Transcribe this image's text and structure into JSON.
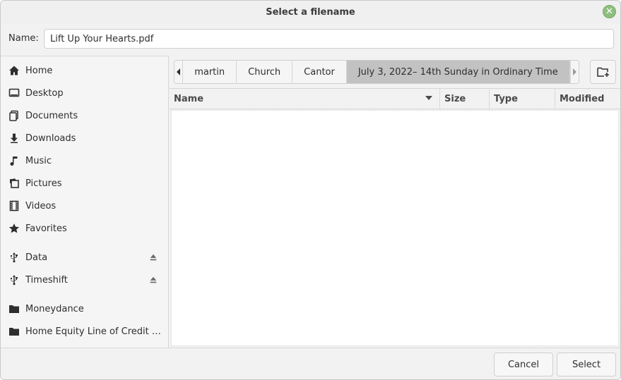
{
  "window": {
    "title": "Select a filename",
    "close_glyph": "✕"
  },
  "name_field": {
    "label": "Name:",
    "value": "Lift Up Your Hearts.pdf"
  },
  "sidebar": {
    "items": [
      {
        "label": "Home",
        "icon": "home-icon"
      },
      {
        "label": "Desktop",
        "icon": "desktop-icon"
      },
      {
        "label": "Documents",
        "icon": "documents-icon"
      },
      {
        "label": "Downloads",
        "icon": "downloads-icon"
      },
      {
        "label": "Music",
        "icon": "music-icon"
      },
      {
        "label": "Pictures",
        "icon": "pictures-icon"
      },
      {
        "label": "Videos",
        "icon": "videos-icon"
      },
      {
        "label": "Favorites",
        "icon": "star-icon"
      },
      {
        "label": "Data",
        "icon": "usb-icon",
        "eject": true
      },
      {
        "label": "Timeshift",
        "icon": "usb-icon",
        "eject": true
      },
      {
        "label": "Moneydance",
        "icon": "folder-icon"
      },
      {
        "label": "Home Equity Line of Credit Re…",
        "icon": "folder-icon"
      }
    ]
  },
  "pathbar": {
    "crumbs": [
      "martin",
      "Church",
      "Cantor",
      "July 3, 2022– 14th Sunday in Ordinary Time"
    ],
    "active_index": 3
  },
  "file_list": {
    "columns": [
      "Name",
      "Size",
      "Type",
      "Modified"
    ],
    "sorted_by": "Name",
    "rows": []
  },
  "buttons": {
    "cancel": "Cancel",
    "select": "Select"
  },
  "colors": {
    "active_crumb": "#c2c2c2",
    "close_button": "#8fbf7f"
  }
}
